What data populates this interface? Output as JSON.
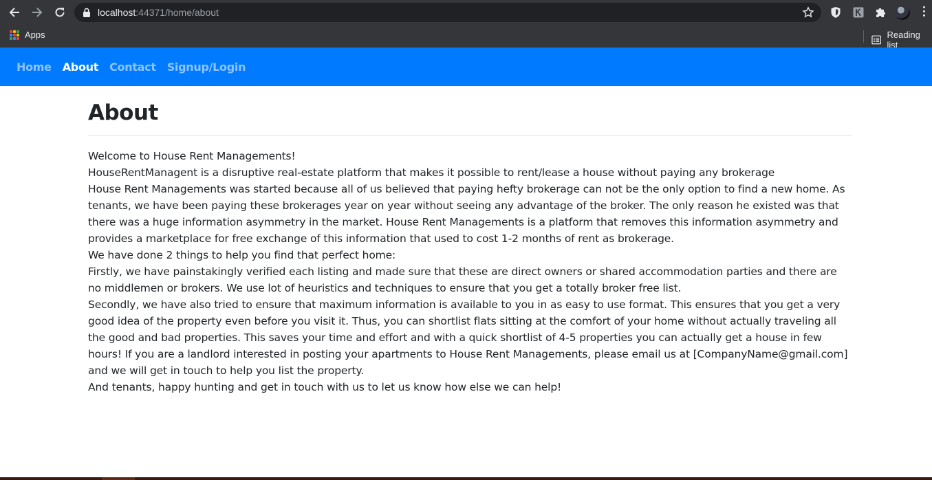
{
  "browser": {
    "url_host": "localhost",
    "url_rest": ":44371/home/about",
    "bookmarks": {
      "apps_label": "Apps",
      "reading_list_label": "Reading list"
    }
  },
  "navbar": {
    "items": [
      {
        "label": "Home",
        "active": false
      },
      {
        "label": "About",
        "active": true
      },
      {
        "label": "Contact",
        "active": false
      },
      {
        "label": "Signup/Login",
        "active": false
      }
    ]
  },
  "page": {
    "title": "About",
    "paragraphs": [
      "Welcome to House Rent Managements!",
      "HouseRentManagent is a disruptive real-estate platform that makes it possible to rent/lease a house without paying any brokerage",
      "House Rent Managements was started because all of us believed that paying hefty brokerage can not be the only option to find a new home. As tenants, we have been paying these brokerages year on year without seeing any advantage of the broker. The only reason he existed was that there was a huge information asymmetry in the market. House Rent Managements is a platform that removes this information asymmetry and provides a marketplace for free exchange of this information that used to cost 1-2 months of rent as brokerage.",
      "We have done 2 things to help you find that perfect home:",
      "Firstly, we have painstakingly verified each listing and made sure that these are direct owners or shared accommodation parties and there are no middlemen or brokers. We use lot of heuristics and techniques to ensure that you get a totally broker free list.",
      "Secondly, we have also tried to ensure that maximum information is available to you in as easy to use format. This ensures that you get a very good idea of the property even before you visit it. Thus, you can shortlist flats sitting at the comfort of your home without actually traveling all the good and bad properties. This saves your time and effort and with a quick shortlist of 4-5 properties you can actually get a house in few hours! If you are a landlord interested in posting your apartments to House Rent Managements, please email us at [CompanyName@gmail.com] and we will get in touch to help you list the property.",
      "And tenants, happy hunting and get in touch with us to let us know how else we can help!"
    ]
  },
  "colors": {
    "navbar": "#007bff",
    "chrome": "#35363a",
    "omnibox": "#202124",
    "text": "#212529"
  }
}
